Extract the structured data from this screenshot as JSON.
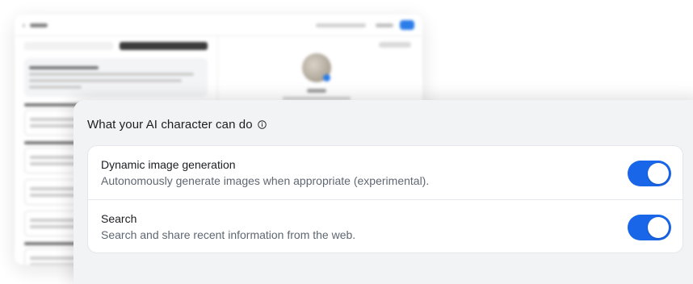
{
  "panel": {
    "title": "What your AI character can do",
    "info_icon": "info-circle-icon",
    "capabilities": [
      {
        "title": "Dynamic image generation",
        "description": "Autonomously generate images when appropriate (experimental).",
        "enabled": true
      },
      {
        "title": "Search",
        "description": "Search and share recent information from the web.",
        "enabled": true
      }
    ]
  },
  "colors": {
    "accent": "#1a66e8",
    "panel_bg": "#f1f3f5",
    "card_bg": "#ffffff",
    "text_primary": "#1c1e21",
    "text_secondary": "#5f6771"
  }
}
